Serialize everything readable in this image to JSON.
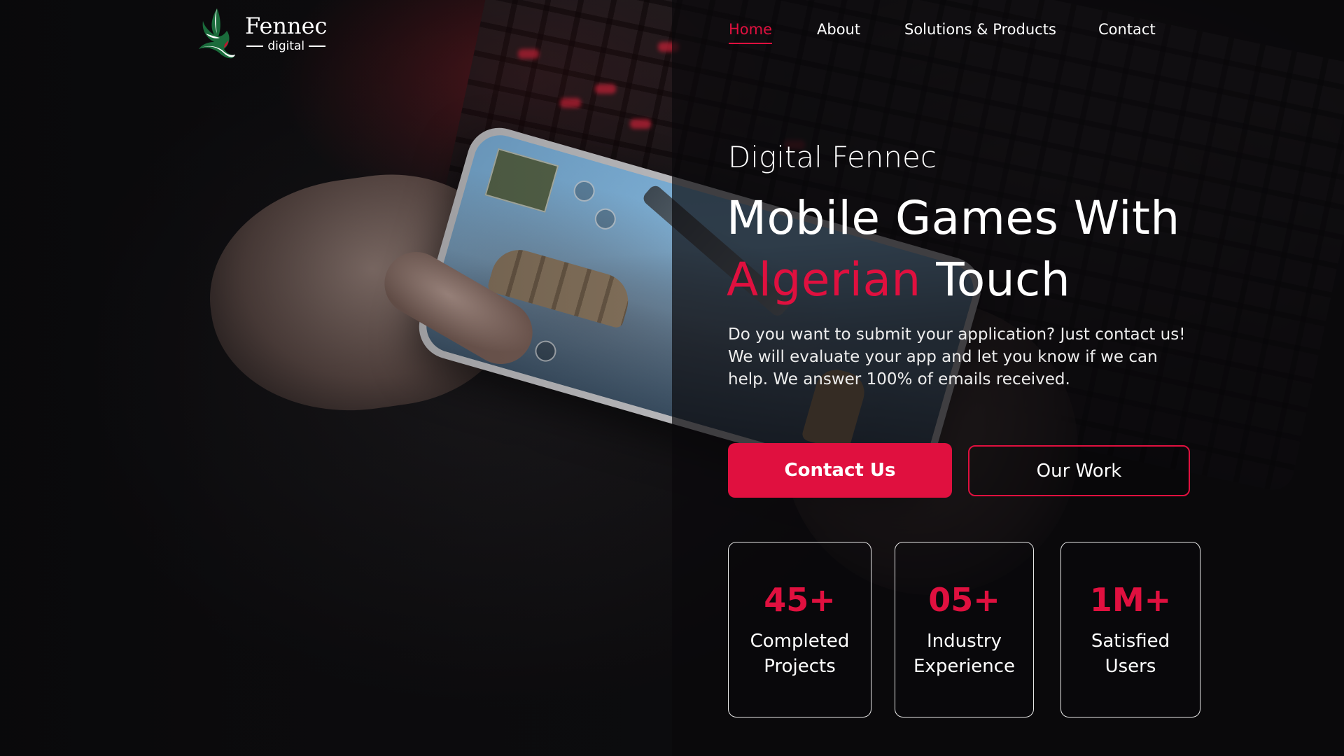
{
  "brand": {
    "name": "Fennec",
    "subtitle": "digital"
  },
  "nav": {
    "items": [
      {
        "label": "Home",
        "active": true
      },
      {
        "label": "About",
        "active": false
      },
      {
        "label": "Solutions & Products",
        "active": false
      },
      {
        "label": "Contact",
        "active": false
      }
    ]
  },
  "hero": {
    "eyebrow": "Digital Fennec",
    "headline_line1": "Mobile Games With",
    "headline_accent": "Algerian",
    "headline_rest": "Touch",
    "description": "Do you want to submit your application? Just contact us! We will evaluate your app and let you know if we can help. We answer 100% of emails received.",
    "primary_cta": "Contact Us",
    "secondary_cta": "Our Work"
  },
  "stats": [
    {
      "value": "45+",
      "label": "Completed Projects"
    },
    {
      "value": "05+",
      "label": "Industry Experience"
    },
    {
      "value": "1M+",
      "label": "Satisfied Users"
    }
  ],
  "colors": {
    "accent": "#e0103f",
    "background": "#0b0a0c",
    "text": "#ffffff"
  }
}
